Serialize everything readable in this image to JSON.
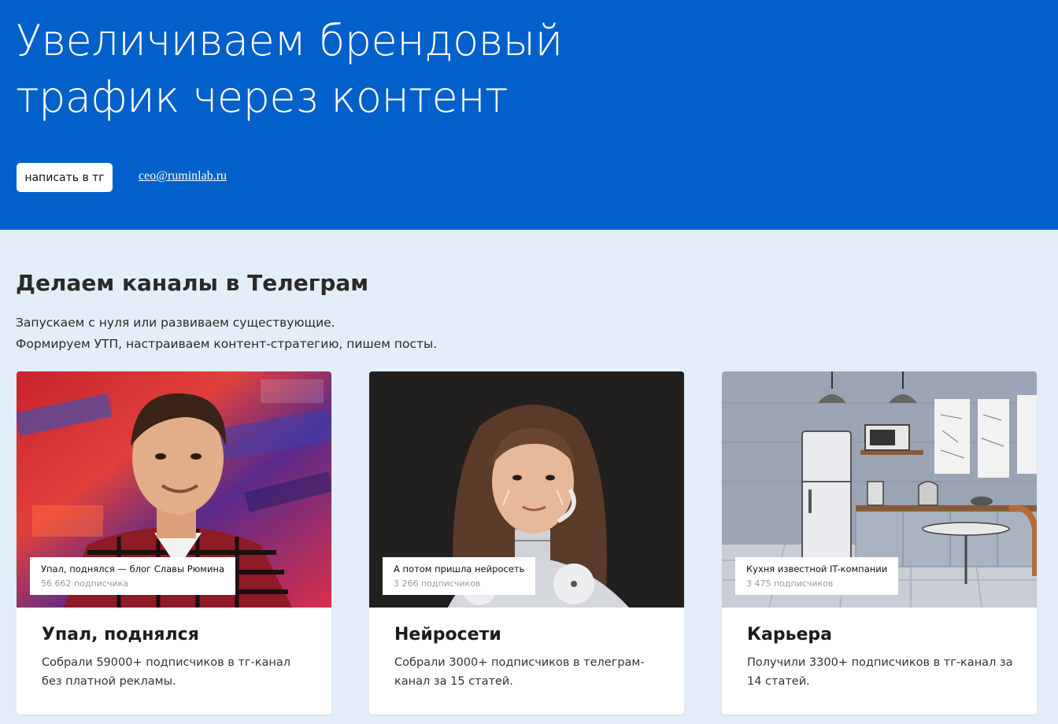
{
  "hero": {
    "title_line1": "Увеличиваем брендовый",
    "title_line2": "трафик через контент",
    "button_label": "написать в тг",
    "email": "ceo@ruminlab.ru"
  },
  "section": {
    "title": "Делаем каналы в Телеграм",
    "desc_line1": "Запускаем с нуля или развиваем существующие.",
    "desc_line2": "Формируем УТП, настраиваем контент-стратегию, пишем посты."
  },
  "cards": [
    {
      "overlay_title": "Упал, поднялся — блог Славы Рюмина",
      "overlay_sub": "56 662 подписчика",
      "title": "Упал, поднялся",
      "desc": "Собрали 59000+ подписчиков в тг-канал без платной рекламы."
    },
    {
      "overlay_title": "А потом пришла нейросеть",
      "overlay_sub": "3 266 подписчиков",
      "title": "Нейросети",
      "desc": "Собрали 3000+ подписчиков в телеграм-канал за 15 статей."
    },
    {
      "overlay_title": "Кухня известной IT-компании",
      "overlay_sub": "3 475 подписчиков",
      "title": "Карьера",
      "desc": "Получили 3300+ подписчиков в тг-канал за 14 статей."
    }
  ],
  "colors": {
    "hero_bg": "#0160c9",
    "page_bg": "#e3eef9",
    "card_bg": "#ffffff"
  }
}
